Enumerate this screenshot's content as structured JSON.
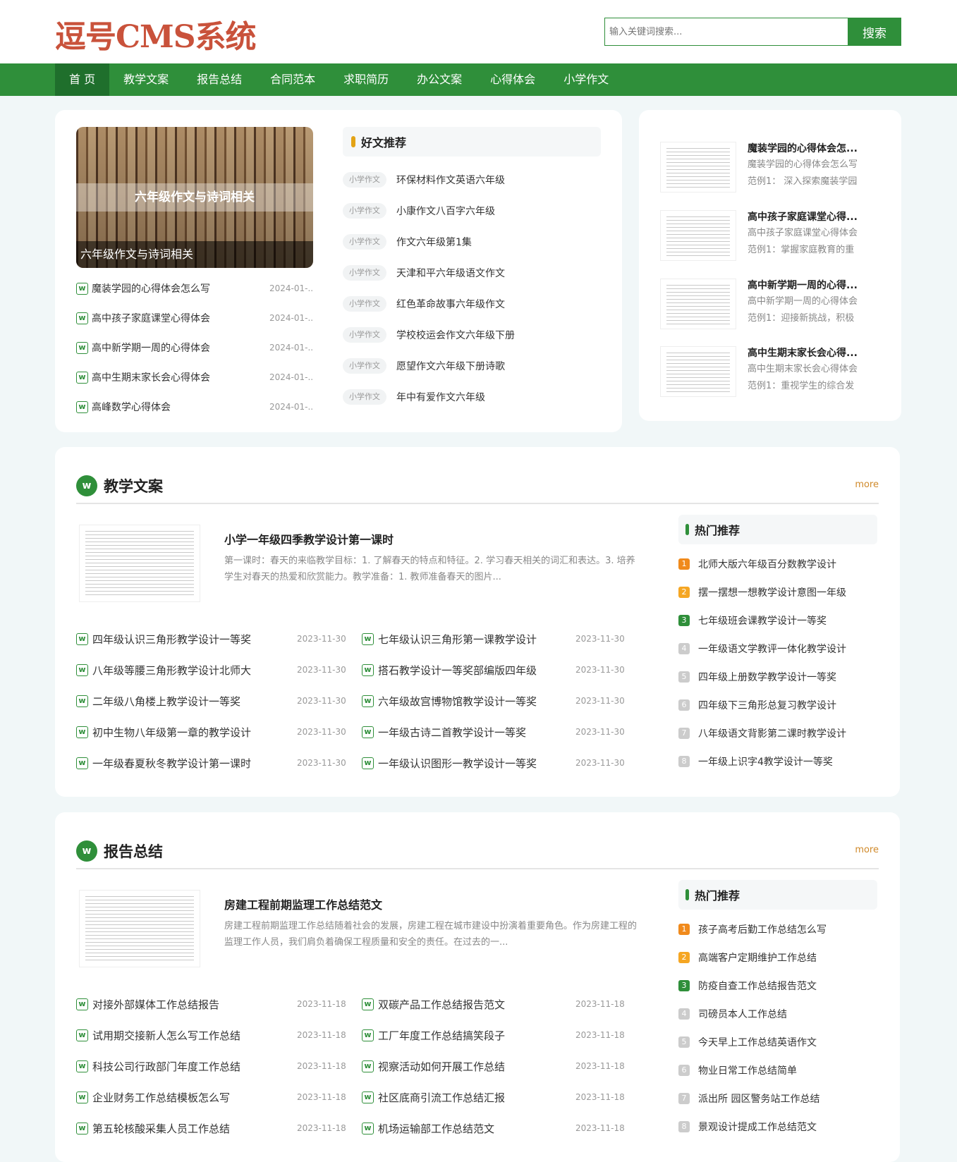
{
  "logo": "逗号CMS系统",
  "search": {
    "placeholder": "输入关键词搜索...",
    "button": "搜索"
  },
  "nav": [
    "首 页",
    "教学文案",
    "报告总结",
    "合同范本",
    "求职简历",
    "办公文案",
    "心得体会",
    "小学作文"
  ],
  "hero": {
    "band": "六年级作文与诗词相关",
    "caption": "六年级作文与诗词相关"
  },
  "latest": [
    {
      "title": "魔装学园的心得体会怎么写",
      "date": "2024-01-..."
    },
    {
      "title": "高中孩子家庭课堂心得体会",
      "date": "2024-01-..."
    },
    {
      "title": "高中新学期一周的心得体会",
      "date": "2024-01-..."
    },
    {
      "title": "高中生期末家长会心得体会",
      "date": "2024-01-..."
    },
    {
      "title": "高峰数学心得体会",
      "date": "2024-01-..."
    }
  ],
  "recommend": {
    "heading": "好文推荐",
    "tag": "小学作文",
    "items": [
      "环保材料作文英语六年级",
      "小康作文八百字六年级",
      "作文六年级第1集",
      "天津和平六年级语文作文",
      "红色革命故事六年级作文",
      "学校校运会作文六年级下册",
      "愿望作文六年级下册诗歌",
      "年中有爱作文六年级"
    ]
  },
  "sidebar": [
    {
      "title": "魔装学园的心得体会怎...",
      "line1": "魔装学园的心得体会怎么写",
      "line2": "范例1： 深入探索魔装学园"
    },
    {
      "title": "高中孩子家庭课堂心得...",
      "line1": "高中孩子家庭课堂心得体会",
      "line2": "范例1：掌握家庭教育的重"
    },
    {
      "title": "高中新学期一周的心得...",
      "line1": "高中新学期一周的心得体会",
      "line2": "范例1：迎接新挑战，积极"
    },
    {
      "title": "高中生期末家长会心得...",
      "line1": "高中生期末家长会心得体会",
      "line2": "范例1：重视学生的综合发"
    }
  ],
  "sections": [
    {
      "title": "教学文案",
      "more": "more",
      "icon": "w",
      "featured": {
        "title": "小学一年级四季教学设计第一课时",
        "desc": "第一课时：春天的来临教学目标：1. 了解春天的特点和特征。2. 学习春天相关的词汇和表达。3. 培养学生对春天的热爱和欣赏能力。教学准备：1. 教师准备春天的图片..."
      },
      "list": [
        {
          "title": "四年级认识三角形教学设计一等奖",
          "date": "2023-11-30"
        },
        {
          "title": "七年级认识三角形第一课教学设计",
          "date": "2023-11-30"
        },
        {
          "title": "八年级等腰三角形教学设计北师大",
          "date": "2023-11-30"
        },
        {
          "title": "搭石教学设计一等奖部编版四年级",
          "date": "2023-11-30"
        },
        {
          "title": "二年级八角楼上教学设计一等奖",
          "date": "2023-11-30"
        },
        {
          "title": "六年级故宫博物馆教学设计一等奖",
          "date": "2023-11-30"
        },
        {
          "title": "初中生物八年级第一章的教学设计",
          "date": "2023-11-30"
        },
        {
          "title": "一年级古诗二首教学设计一等奖",
          "date": "2023-11-30"
        },
        {
          "title": "一年级春夏秋冬教学设计第一课时",
          "date": "2023-11-30"
        },
        {
          "title": "一年级认识图形一教学设计一等奖",
          "date": "2023-11-30"
        }
      ],
      "hot_title": "热门推荐",
      "hot": [
        "北师大版六年级百分数教学设计",
        "摆一摆想一想教学设计意图一年级",
        "七年级班会课教学设计一等奖",
        "一年级语文学教评一体化教学设计",
        "四年级上册数学教学设计一等奖",
        "四年级下三角形总复习教学设计",
        "八年级语文背影第二课时教学设计",
        "一年级上识字4教学设计一等奖"
      ]
    },
    {
      "title": "报告总结",
      "more": "more",
      "icon": "w",
      "featured": {
        "title": "房建工程前期监理工作总结范文",
        "desc": "房建工程前期监理工作总结随着社会的发展，房建工程在城市建设中扮演着重要角色。作为房建工程的监理工作人员，我们肩负着确保工程质量和安全的责任。在过去的一..."
      },
      "list": [
        {
          "title": "对接外部媒体工作总结报告",
          "date": "2023-11-18"
        },
        {
          "title": "双碳产品工作总结报告范文",
          "date": "2023-11-18"
        },
        {
          "title": "试用期交接新人怎么写工作总结",
          "date": "2023-11-18"
        },
        {
          "title": "工厂年度工作总结搞笑段子",
          "date": "2023-11-18"
        },
        {
          "title": "科技公司行政部门年度工作总结",
          "date": "2023-11-18"
        },
        {
          "title": "视察活动如何开展工作总结",
          "date": "2023-11-18"
        },
        {
          "title": "企业财务工作总结模板怎么写",
          "date": "2023-11-18"
        },
        {
          "title": "社区底商引流工作总结汇报",
          "date": "2023-11-18"
        },
        {
          "title": "第五轮核酸采集人员工作总结",
          "date": "2023-11-18"
        },
        {
          "title": "机场运输部工作总结范文",
          "date": "2023-11-18"
        }
      ],
      "hot_title": "热门推荐",
      "hot": [
        "孩子高考后勤工作总结怎么写",
        "高端客户定期维护工作总结",
        "防疫自查工作总结报告范文",
        "司磅员本人工作总结",
        "今天早上工作总结英语作文",
        "物业日常工作总结简单",
        "派出所 园区警务站工作总结",
        "景观设计提成工作总结范文"
      ]
    }
  ]
}
